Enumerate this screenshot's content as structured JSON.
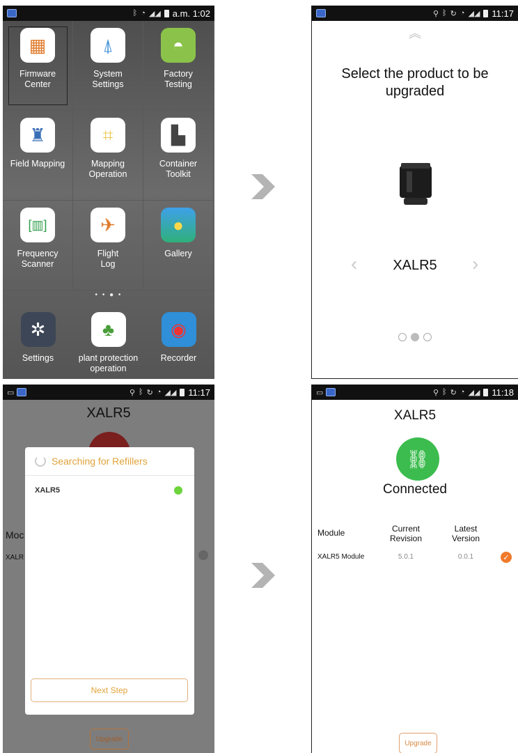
{
  "screen1": {
    "status_time": "a.m. 1:02",
    "apps": [
      {
        "label": "Firmware\nCenter",
        "icon": "chip-icon"
      },
      {
        "label": "System\nSettings",
        "icon": "survey-pole-icon"
      },
      {
        "label": "Factory\nTesting",
        "icon": "android-icon"
      },
      {
        "label": "Field Mapping",
        "icon": "person-mapping-icon"
      },
      {
        "label": "Mapping\nOperation",
        "icon": "drone-grid-icon"
      },
      {
        "label": "Container\nToolkit",
        "icon": "container-icon"
      },
      {
        "label": "Frequency\nScanner",
        "icon": "signal-scan-icon"
      },
      {
        "label": "Flight\nLog",
        "icon": "flight-log-icon"
      },
      {
        "label": "Gallery",
        "icon": "gallery-icon"
      }
    ],
    "page_dots": "• • ● •",
    "dock": [
      {
        "label": "Settings",
        "icon": "gear-icon"
      },
      {
        "label": "plant protection\noperation",
        "icon": "plant-protection-icon"
      },
      {
        "label": "Recorder",
        "icon": "disc-icon"
      }
    ]
  },
  "screen2": {
    "status_time": "11:17",
    "title": "Select the product to be upgraded",
    "product_name": "XALR5",
    "pages": 3,
    "active_page": 1
  },
  "screen3": {
    "status_time": "11:17",
    "background_title": "XALR5",
    "background_module": "Moc",
    "background_row": "XALR",
    "dialog_title": "Searching for Refillers",
    "device_name": "XALR5",
    "next_button": "Next Step",
    "upgrade_button": "Upgrade"
  },
  "screen4": {
    "status_time": "11:18",
    "title": "XALR5",
    "status": "Connected",
    "headers": {
      "module": "Module",
      "current": "Current\nRevision",
      "latest": "Latest\nVersion"
    },
    "row": {
      "module": "XALR5 Module",
      "current": "5.0.1",
      "latest": "0.0.1"
    },
    "upgrade_button": "Upgrade"
  },
  "colors": {
    "accent": "#e0a33a",
    "connected": "#3cbc4e",
    "device_online": "#6dd43c",
    "update_check": "#f07a2a"
  }
}
